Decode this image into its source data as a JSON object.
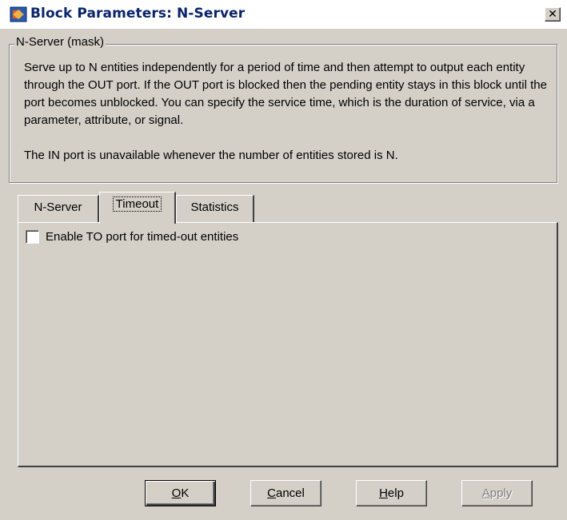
{
  "window": {
    "title": "Block Parameters: N-Server",
    "close_glyph": "✕"
  },
  "group": {
    "label": "N-Server (mask)",
    "paragraph1": "Serve up to N entities independently for a period of time and then attempt to output each entity through the OUT port. If the OUT port is blocked then the pending entity stays in this block until the port becomes unblocked. You can specify the service time, which is the duration of service, via a parameter, attribute, or signal.",
    "paragraph2": "The IN port is unavailable whenever the number of entities stored is N."
  },
  "tabs": [
    {
      "label": "N-Server"
    },
    {
      "label": "Timeout"
    },
    {
      "label": "Statistics"
    }
  ],
  "active_tab": "Timeout",
  "timeout_panel": {
    "enable_to_port": {
      "label": "Enable TO port for timed-out entities",
      "checked": false
    }
  },
  "buttons": {
    "ok": {
      "mnemonic": "O",
      "rest": "K"
    },
    "cancel": {
      "mnemonic": "C",
      "rest": "ancel"
    },
    "help": {
      "mnemonic": "H",
      "rest": "elp"
    },
    "apply": {
      "mnemonic": "A",
      "rest": "pply",
      "enabled": false
    }
  }
}
